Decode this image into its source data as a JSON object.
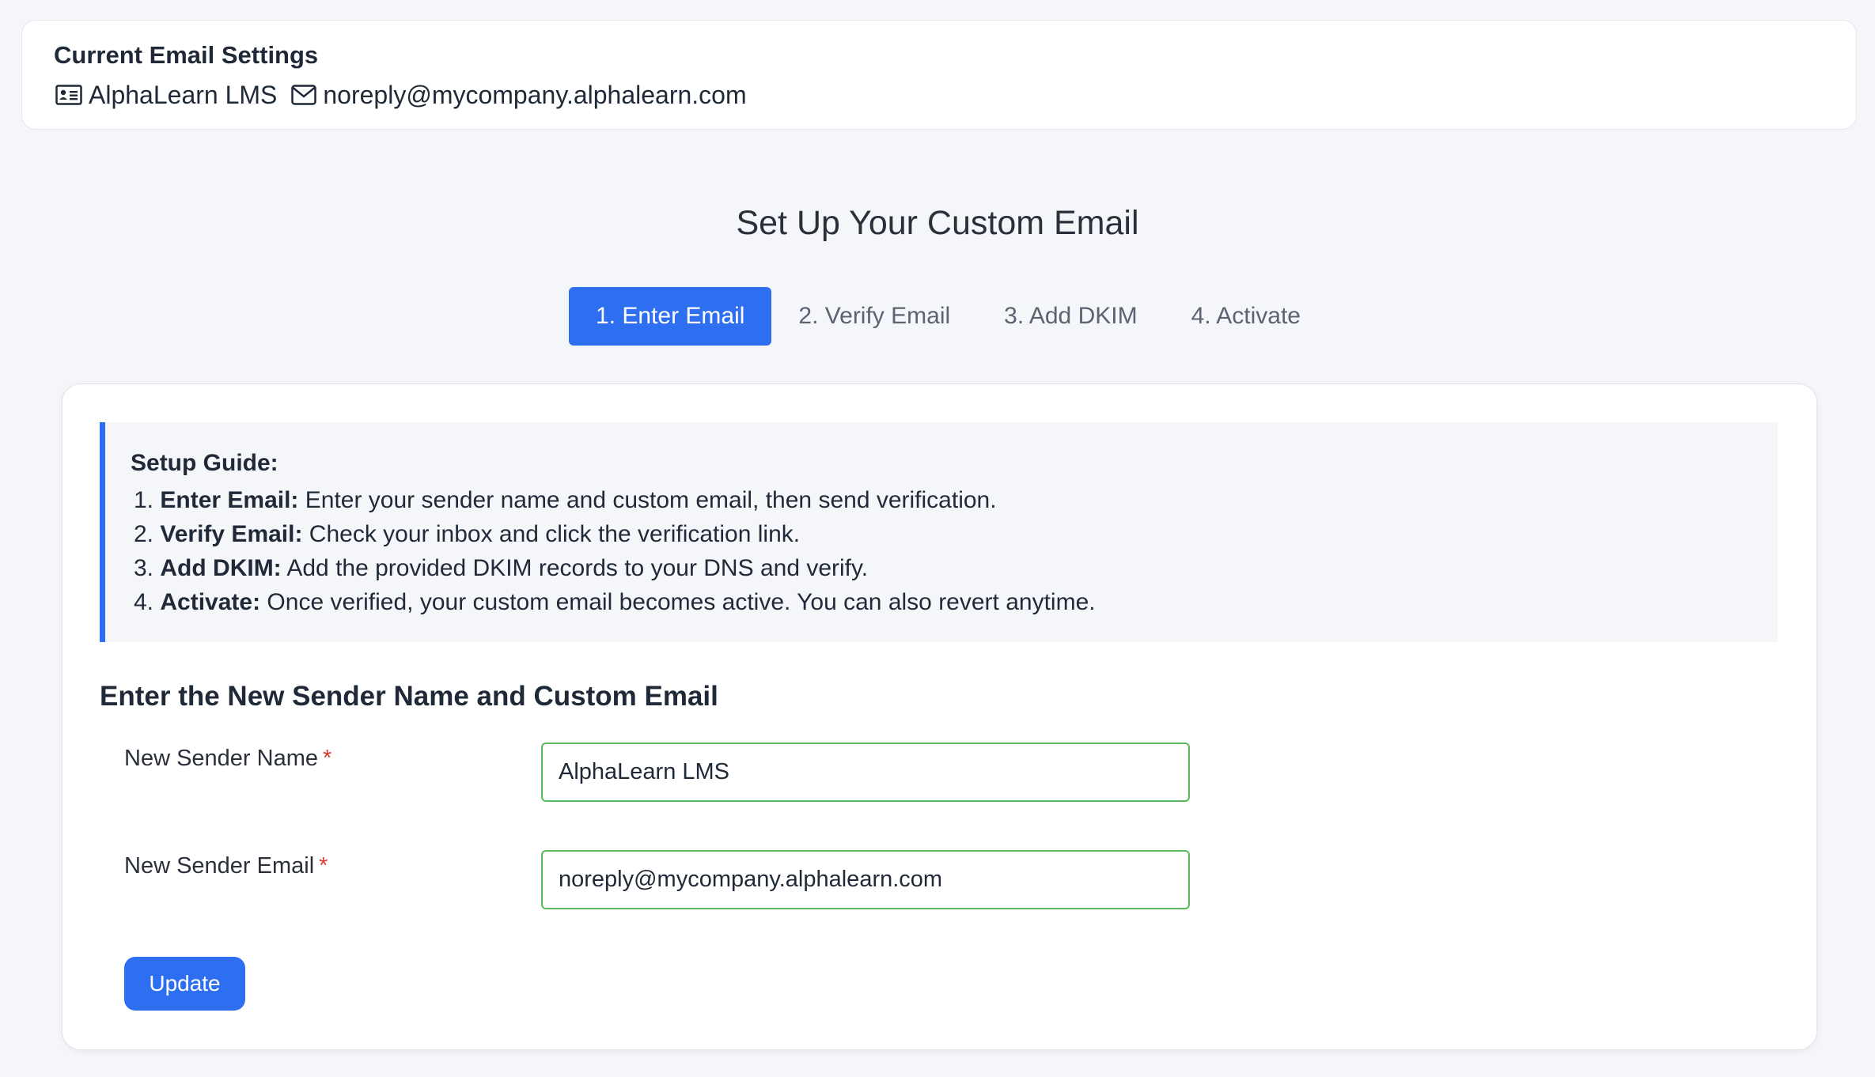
{
  "current_settings": {
    "title": "Current Email Settings",
    "sender_name": "AlphaLearn LMS",
    "sender_email": "noreply@mycompany.alphalearn.com",
    "name_icon": "id-card-icon",
    "email_icon": "envelope-icon"
  },
  "page": {
    "heading": "Set Up Your Custom Email"
  },
  "steps": [
    {
      "label": "1. Enter Email",
      "active": true
    },
    {
      "label": "2. Verify Email",
      "active": false
    },
    {
      "label": "3. Add DKIM",
      "active": false
    },
    {
      "label": "4. Activate",
      "active": false
    }
  ],
  "guide": {
    "title": "Setup Guide:",
    "items": [
      {
        "num": "1.",
        "term": "Enter Email:",
        "text": " Enter your sender name and custom email, then send verification."
      },
      {
        "num": "2.",
        "term": "Verify Email:",
        "text": " Check your inbox and click the verification link."
      },
      {
        "num": "3.",
        "term": "Add DKIM:",
        "text": " Add the provided DKIM records to your DNS and verify."
      },
      {
        "num": "4.",
        "term": "Activate:",
        "text": " Once verified, your custom email becomes active. You can also revert anytime."
      }
    ]
  },
  "form": {
    "heading": "Enter the New Sender Name and Custom Email",
    "name_label": "New Sender Name",
    "name_value": "AlphaLearn LMS",
    "email_label": "New Sender Email",
    "email_value": "noreply@mycompany.alphalearn.com",
    "required_mark": "*",
    "submit_label": "Update"
  },
  "colors": {
    "accent": "#2e6ff2",
    "valid_border": "#5cb85c",
    "required": "#d63b2f"
  }
}
